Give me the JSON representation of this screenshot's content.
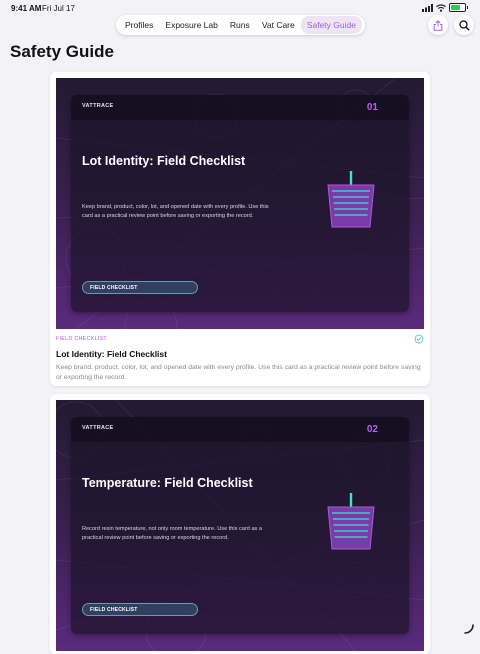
{
  "status": {
    "time": "9:41 AM",
    "date": "Fri Jul 17"
  },
  "tabs": [
    {
      "label": "Profiles"
    },
    {
      "label": "Exposure Lab"
    },
    {
      "label": "Runs"
    },
    {
      "label": "Vat Care"
    },
    {
      "label": "Safety Guide"
    }
  ],
  "active_tab": "Safety Guide",
  "page": {
    "title": "Safety Guide"
  },
  "cards": [
    {
      "brand": "VATTRACE",
      "number": "01",
      "title": "Lot Identity: Field Checklist",
      "description": "Keep brand, product, color, lot, and opened date with every profile. Use this card as a practical review point before saving or exporting the record.",
      "pill": "FIELD CHECKLIST",
      "tag": "FIELD CHECKLIST",
      "meta_title": "Lot Identity: Field Checklist",
      "meta_description": "Keep brand, product, color, lot, and opened date with every profile. Use this card as a practical review point before saving or exporting the record."
    },
    {
      "brand": "VATTRACE",
      "number": "02",
      "title": "Temperature: Field Checklist",
      "description": "Record resin temperature, not only room temperature. Use this card as a practical review point before saving or exporting the record.",
      "pill": "FIELD CHECKLIST"
    }
  ],
  "colors": {
    "accent": "#a45cd6",
    "banner_dark": "#231a33",
    "banner_light": "#5b2a7e",
    "number": "#b45ff0",
    "beaker_line": "#42e0d0"
  },
  "icons": [
    "signal-icon",
    "wifi-icon",
    "battery-icon",
    "share-icon",
    "search-icon",
    "beaker-icon",
    "checkmark-circle-icon",
    "resize-grabber-icon"
  ]
}
